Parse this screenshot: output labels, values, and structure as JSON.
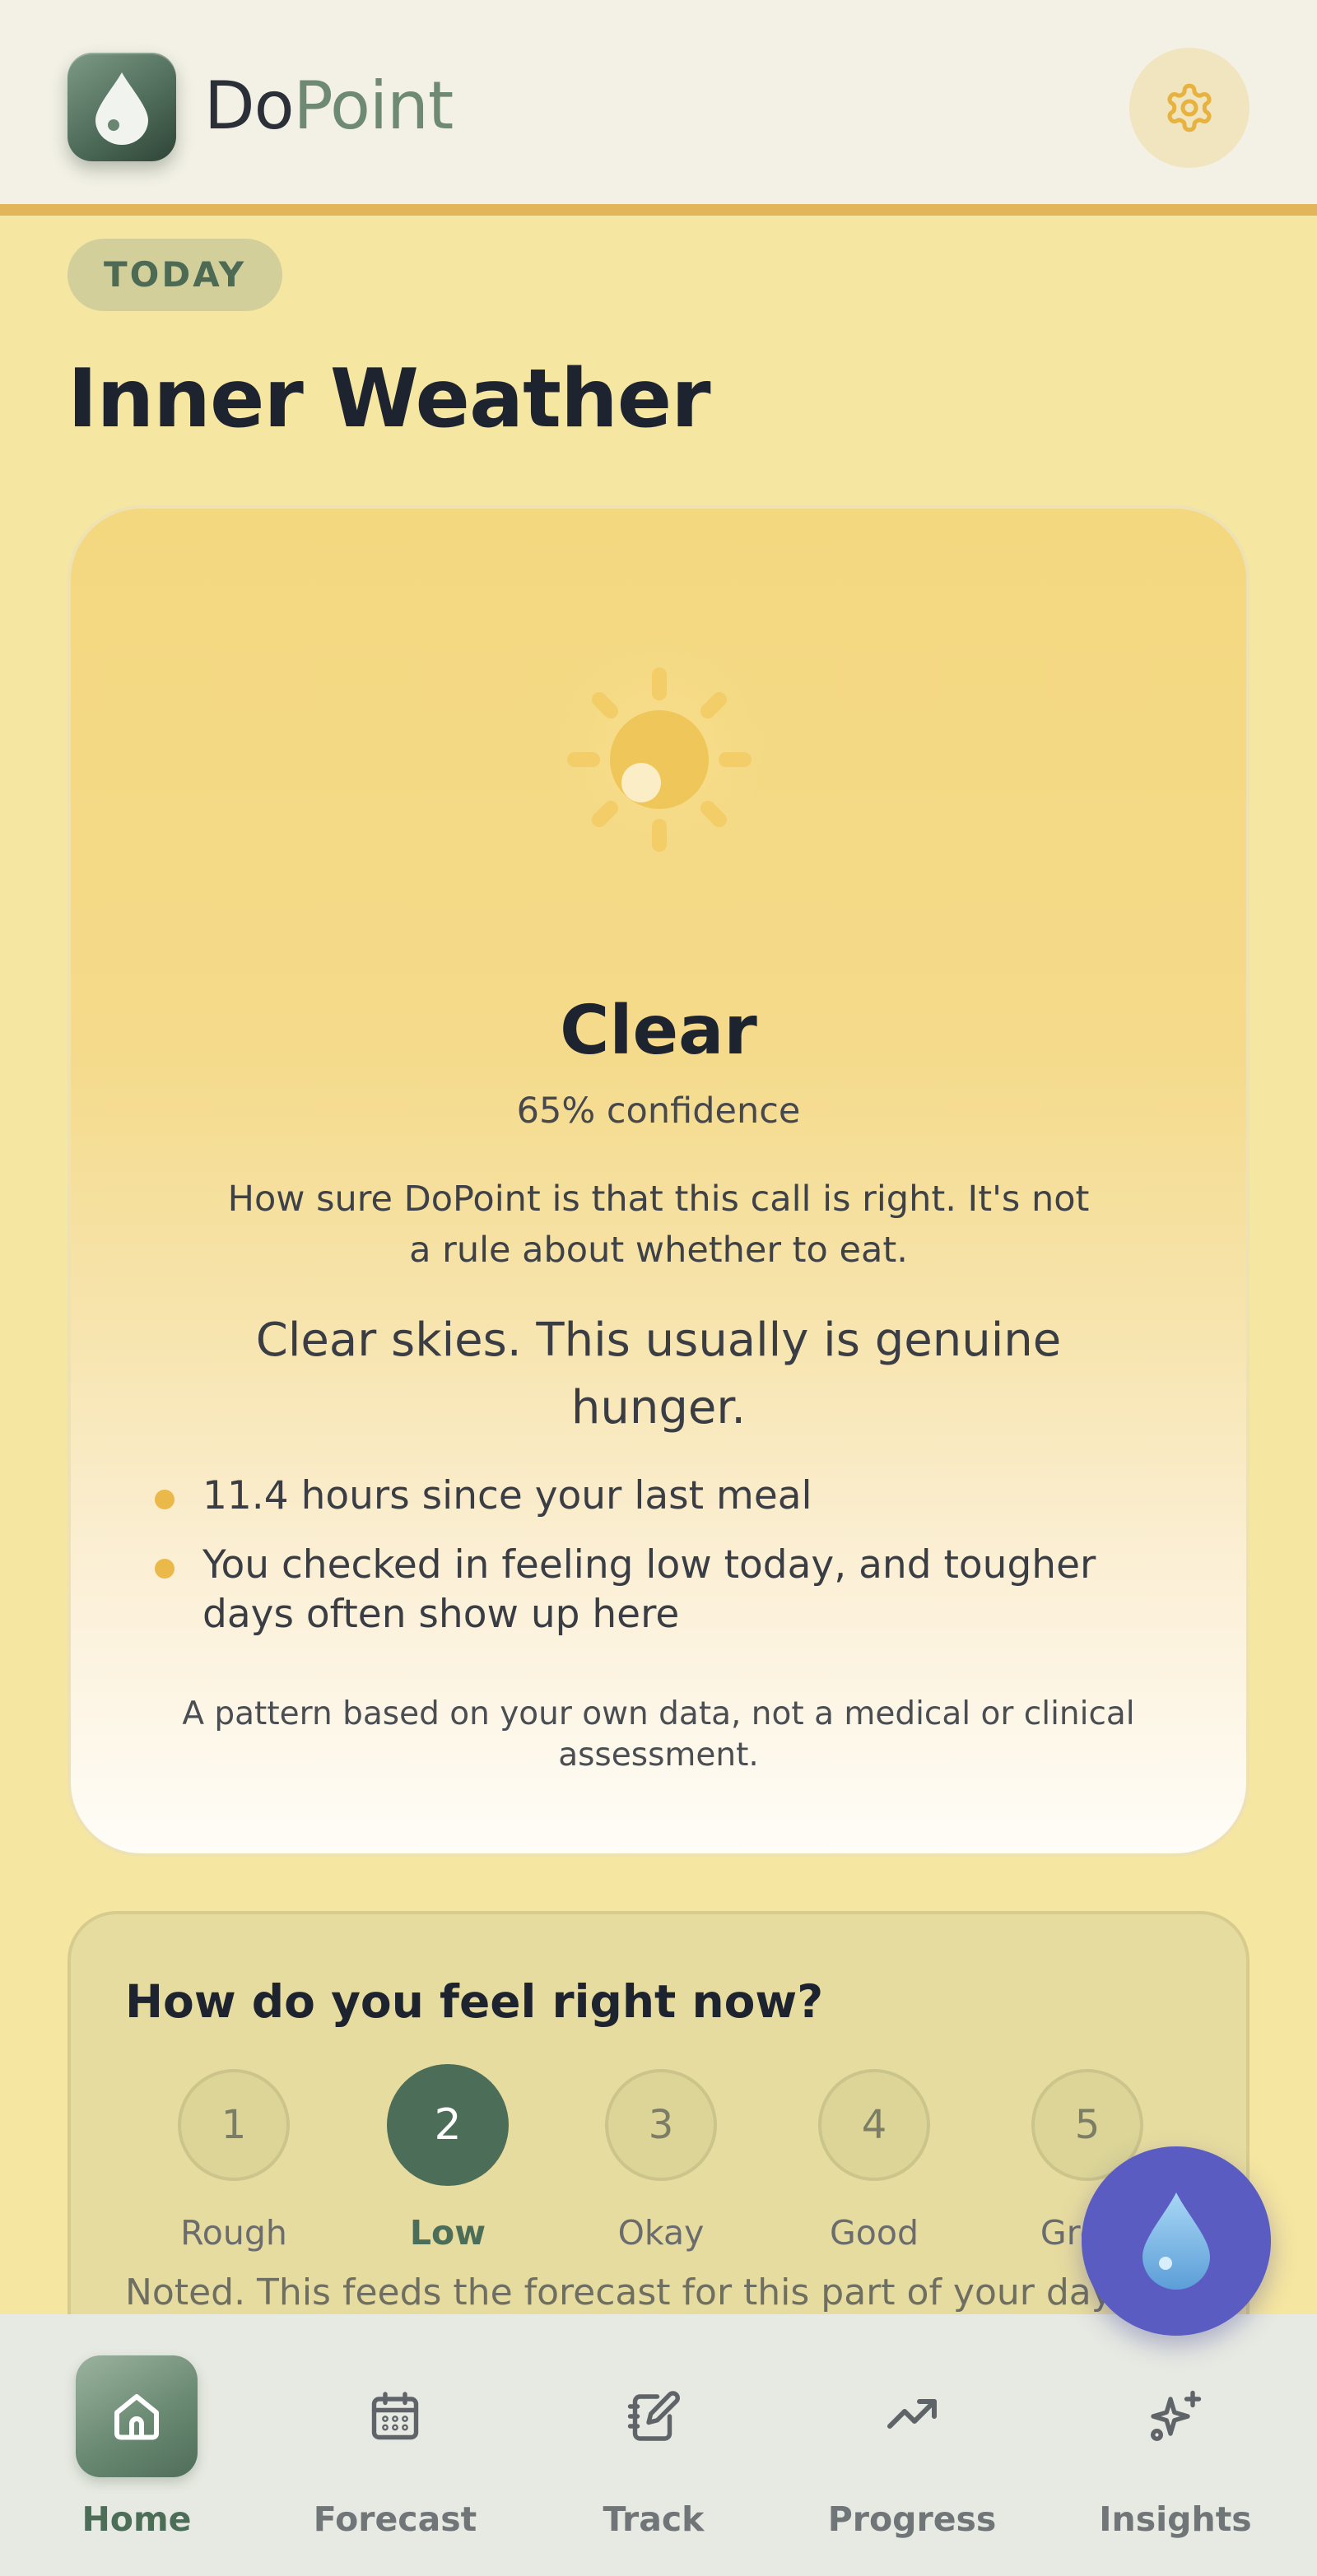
{
  "app": {
    "brand_part_1": "Do",
    "brand_part_2": "Point"
  },
  "header": {
    "settings_icon": "gear-icon",
    "logo_icon": "water-drop-icon"
  },
  "page": {
    "date_label": "TODAY",
    "title": "Inner Weather"
  },
  "forecast": {
    "icon": "sun-icon",
    "condition": "Clear",
    "confidence": "65% confidence",
    "confidence_explainer": "How sure DoPoint is that this call is right. It's not a rule about whether to eat.",
    "message": "Clear skies. This usually is genuine hunger.",
    "reasons": [
      "11.4 hours since your last meal",
      "You checked in feeling low today, and tougher days often show up here"
    ],
    "disclaimer": "A pattern based on your own data, not a medical or clinical assessment."
  },
  "mood": {
    "question": "How do you feel right now?",
    "options": [
      {
        "value": "1",
        "label": "Rough"
      },
      {
        "value": "2",
        "label": "Low"
      },
      {
        "value": "3",
        "label": "Okay"
      },
      {
        "value": "4",
        "label": "Good"
      },
      {
        "value": "5",
        "label": "Great"
      }
    ],
    "selected_value": "2",
    "feedback": "Noted. This feeds the forecast for this part of your day."
  },
  "fab": {
    "icon": "water-drop-icon"
  },
  "nav": {
    "items": [
      {
        "label": "Home",
        "icon": "home-icon"
      },
      {
        "label": "Forecast",
        "icon": "calendar-icon"
      },
      {
        "label": "Track",
        "icon": "notebook-pen-icon"
      },
      {
        "label": "Progress",
        "icon": "trend-up-icon"
      },
      {
        "label": "Insights",
        "icon": "sparkles-icon"
      }
    ],
    "active": "Home"
  },
  "colors": {
    "background": "#f5e6a1",
    "accent": "#e2b558",
    "brand_green": "#4c6e58",
    "fab": "#5b5cc2"
  }
}
